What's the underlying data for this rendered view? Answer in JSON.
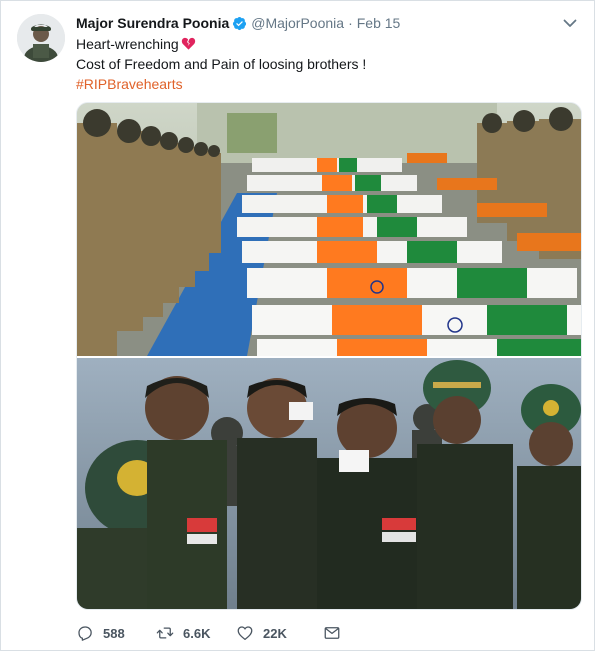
{
  "tweet": {
    "display_name": "Major Surendra Poonia",
    "handle": "@MajorPoonia",
    "separator": "·",
    "date": "Feb 15",
    "text_line1": "Heart-wrenching",
    "text_line2": "Cost of Freedom and Pain of loosing brothers !",
    "hashtag": "#RIPBravehearts"
  },
  "actions": {
    "replies": "588",
    "retweets": "6.6K",
    "likes": "22K"
  },
  "icons": {
    "verified": "verified-badge-icon",
    "caret": "chevron-down-icon",
    "emoji": "broken-heart-icon",
    "reply": "reply-icon",
    "retweet": "retweet-icon",
    "like": "heart-icon",
    "dm": "envelope-icon"
  },
  "colors": {
    "hashtag": "#e0622a",
    "verified": "#1da1f2",
    "text": "#14171a",
    "muted": "#657786"
  }
}
